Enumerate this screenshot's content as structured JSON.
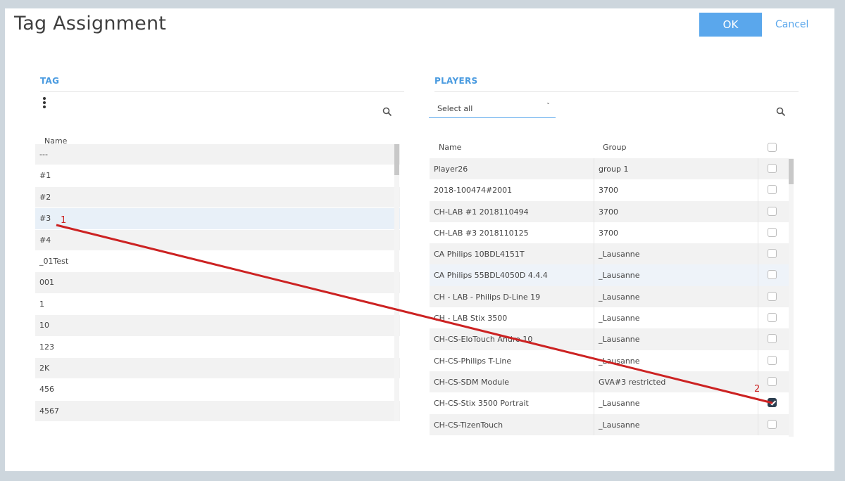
{
  "dialog": {
    "title": "Tag Assignment",
    "ok_label": "OK",
    "cancel_label": "Cancel"
  },
  "tag_panel": {
    "header": "TAG",
    "column_name": "Name",
    "menu_icon": "kebab-vertical-icon",
    "search_icon": "search-icon",
    "rows": [
      "---",
      "#1",
      "#2",
      "#3",
      "#4",
      "_01Test",
      "001",
      "1",
      "10",
      "123",
      "2K",
      "456",
      "4567"
    ],
    "highlighted_row": "#3"
  },
  "players_panel": {
    "header": "PLAYERS",
    "select_all_label": "Select all",
    "search_icon": "search-icon",
    "columns": {
      "name": "Name",
      "group": "Group"
    },
    "rows": [
      {
        "name": "Player26",
        "group": "group 1",
        "checked": false
      },
      {
        "name": "2018-100474#2001",
        "group": "3700",
        "checked": false
      },
      {
        "name": "CH-LAB #1 2018110494",
        "group": "3700",
        "checked": false
      },
      {
        "name": "CH-LAB #3 2018110125",
        "group": "3700",
        "checked": false
      },
      {
        "name": "CA Philips 10BDL4151T",
        "group": "_Lausanne",
        "checked": false
      },
      {
        "name": "CA Philips 55BDL4050D 4.4.4",
        "group": "_Lausanne",
        "checked": false
      },
      {
        "name": "CH - LAB - Philips D-Line 19",
        "group": "_Lausanne",
        "checked": false
      },
      {
        "name": "CH - LAB Stix 3500",
        "group": "_Lausanne",
        "checked": false
      },
      {
        "name": "CH-CS-EloTouch Andro 10",
        "group": "_Lausanne",
        "checked": false
      },
      {
        "name": "CH-CS-Philips T-Line",
        "group": "_Lausanne",
        "checked": false
      },
      {
        "name": "CH-CS-SDM Module",
        "group": "GVA#3 restricted",
        "checked": false
      },
      {
        "name": "CH-CS-Stix 3500 Portrait",
        "group": "_Lausanne",
        "checked": true
      },
      {
        "name": "CH-CS-TizenTouch",
        "group": "_Lausanne",
        "checked": false
      }
    ]
  },
  "annotations": {
    "marker1": "1",
    "marker2": "2",
    "arrow_color": "#cc2222"
  },
  "colors": {
    "accent": "#5aa7ec",
    "checkbox_checked": "#2c3e50"
  }
}
